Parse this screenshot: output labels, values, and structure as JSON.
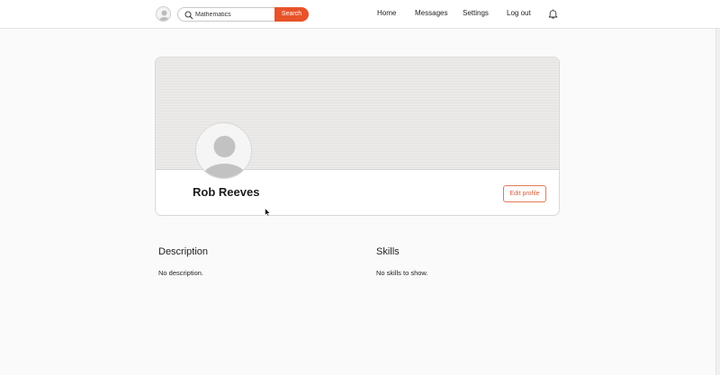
{
  "header": {
    "search": {
      "value": "Mathematics",
      "button_label": "Search"
    },
    "nav": {
      "home": "Home",
      "messages": "Messages",
      "settings": "Settings",
      "logout": "Log out"
    },
    "icons": {
      "avatar": "user-avatar-icon",
      "search": "search-icon",
      "notifications": "bell-icon"
    }
  },
  "profile": {
    "name": "Rob Reeves",
    "edit_label": "Edit profile"
  },
  "sections": {
    "description": {
      "title": "Description",
      "text": "No description."
    },
    "skills": {
      "title": "Skills",
      "text": "No skills to show."
    }
  },
  "colors": {
    "accent": "#e8532a",
    "accent_border": "#e07a5a",
    "background": "#fbfafb"
  }
}
